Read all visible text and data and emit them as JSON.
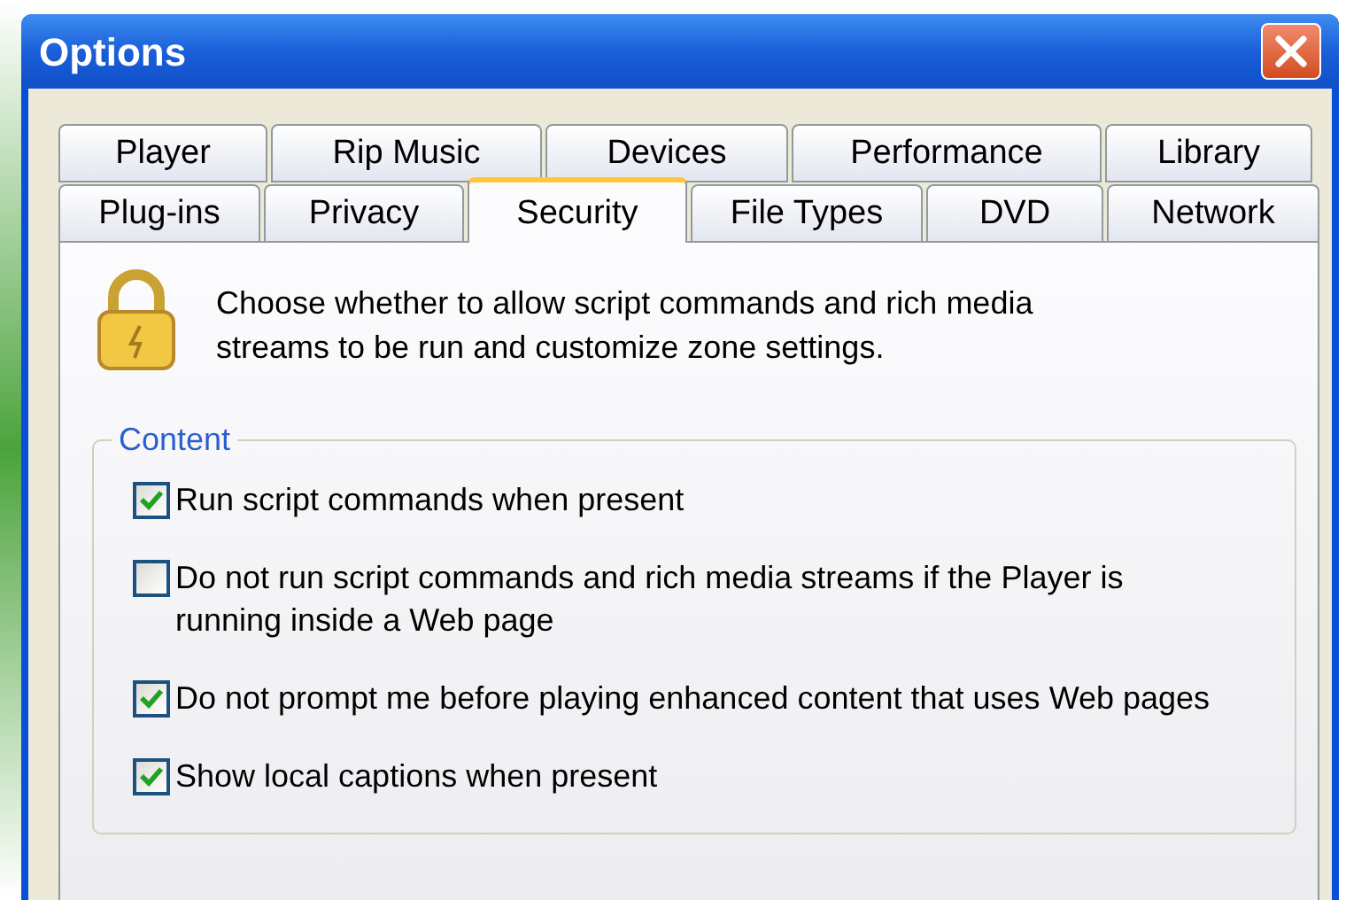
{
  "window": {
    "title": "Options"
  },
  "tab_rows": [
    [
      {
        "label": "Player",
        "selected": false
      },
      {
        "label": "Rip Music",
        "selected": false
      },
      {
        "label": "Devices",
        "selected": false
      },
      {
        "label": "Performance",
        "selected": false
      },
      {
        "label": "Library",
        "selected": false
      }
    ],
    [
      {
        "label": "Plug-ins",
        "selected": false
      },
      {
        "label": "Privacy",
        "selected": false
      },
      {
        "label": "Security",
        "selected": true
      },
      {
        "label": "File Types",
        "selected": false
      },
      {
        "label": "DVD",
        "selected": false
      },
      {
        "label": "Network",
        "selected": false
      }
    ]
  ],
  "description": "Choose whether to allow script commands and rich media streams to be run and customize zone settings.",
  "content": {
    "title": "Content",
    "options": [
      {
        "label": "Run script commands when present",
        "checked": true
      },
      {
        "label": "Do not run script commands and rich media streams if the Player is running inside a Web page",
        "checked": false
      },
      {
        "label": "Do not prompt me before playing enhanced content that uses Web pages",
        "checked": true
      },
      {
        "label": "Show local captions when present",
        "checked": true
      }
    ]
  }
}
